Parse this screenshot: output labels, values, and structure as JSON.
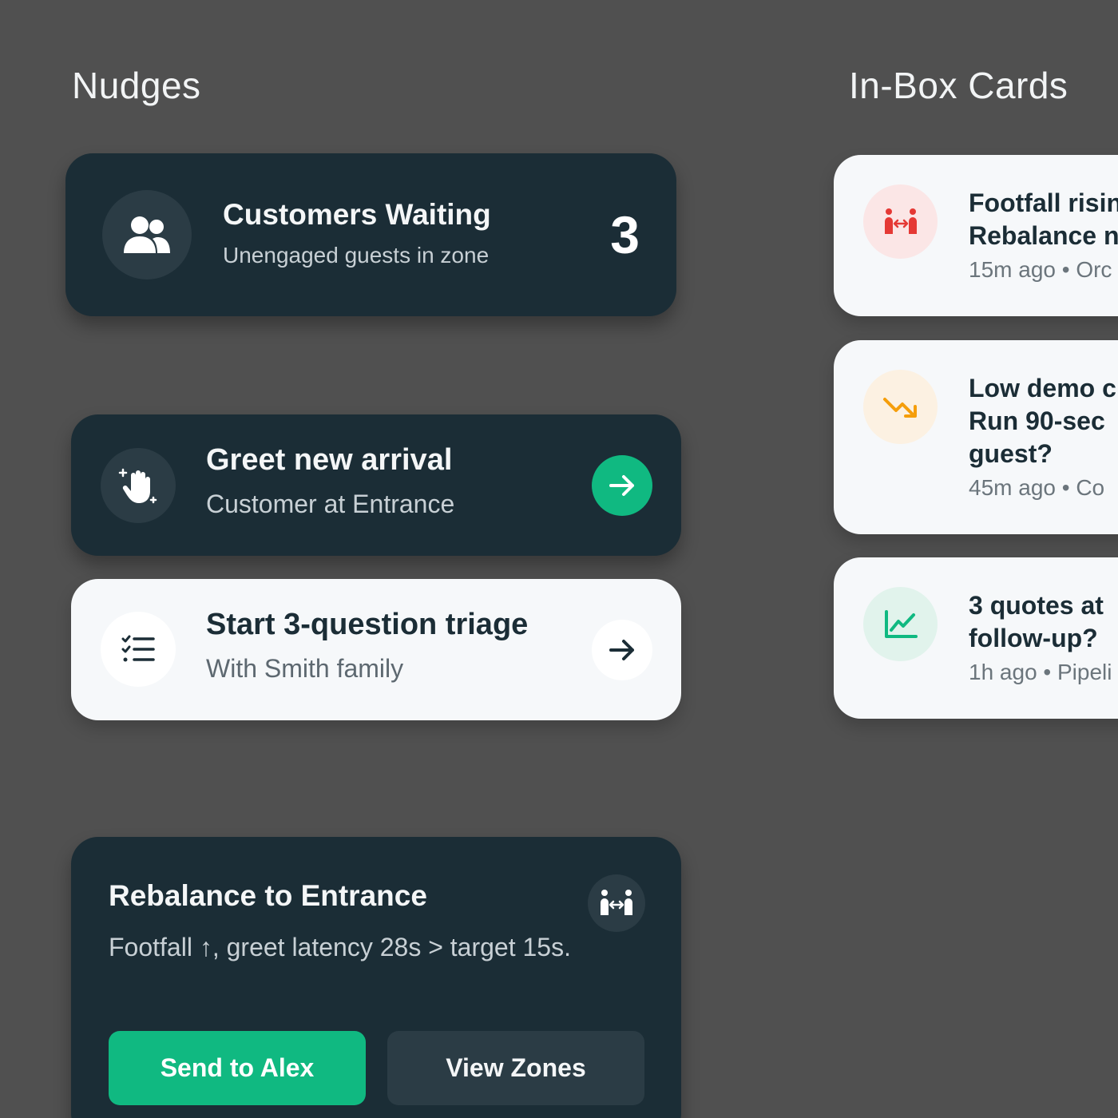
{
  "sections": {
    "nudges": "Nudges",
    "inbox": "In-Box Cards"
  },
  "nudges": {
    "customers": {
      "title": "Customers Waiting",
      "subtitle": "Unengaged guests in zone",
      "count": "3",
      "icon": "users-icon"
    },
    "greet": {
      "title": "Greet new arrival",
      "subtitle": "Customer at Entrance",
      "icon": "wave-hand-icon",
      "action_icon": "arrow-right-icon"
    },
    "triage": {
      "title": "Start 3-question triage",
      "subtitle": "With Smith family",
      "icon": "checklist-icon",
      "action_icon": "arrow-right-icon"
    },
    "rebalance": {
      "title": "Rebalance to Entrance",
      "body": "Footfall ↑, greet latency 28s > target 15s.",
      "icon": "rebalance-people-icon",
      "primary_button": "Send to Alex",
      "secondary_button": "View Zones"
    }
  },
  "inbox_cards": [
    {
      "line1": "Footfall risin",
      "line2": "Rebalance n",
      "meta": "15m ago • Orc",
      "icon": "rebalance-people-icon",
      "color": "#e53935"
    },
    {
      "line1": "Low demo c",
      "line2": "Run 90-sec",
      "line3": "guest?",
      "meta": "45m ago • Co",
      "icon": "trending-down-icon",
      "color": "#f59e0b"
    },
    {
      "line1": "3 quotes at",
      "line2": "follow-up?",
      "meta": "1h ago • Pipeli",
      "icon": "line-chart-icon",
      "color": "#10b981"
    }
  ],
  "colors": {
    "accent": "#10b981",
    "card_dark": "#1b2d36",
    "card_light": "#f6f8fa",
    "background": "#505050"
  }
}
